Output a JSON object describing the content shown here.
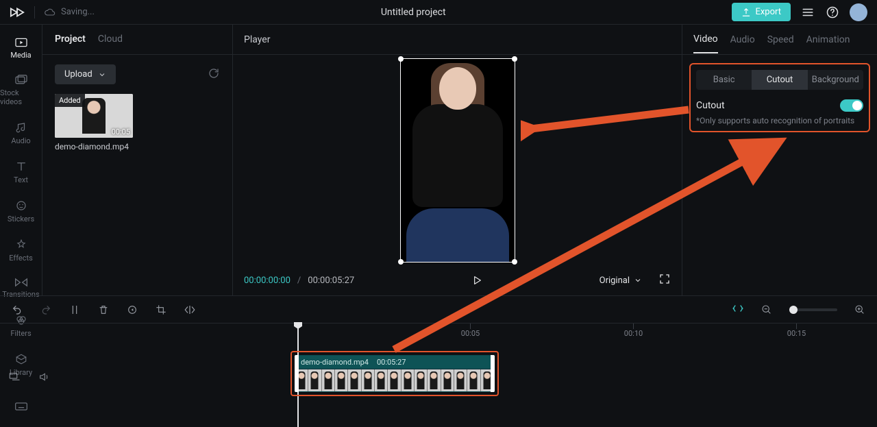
{
  "topbar": {
    "saving": "Saving...",
    "title": "Untitled project",
    "export": "Export"
  },
  "rail": {
    "items": [
      "Media",
      "Stock videos",
      "Audio",
      "Text",
      "Stickers",
      "Effects",
      "Transitions",
      "Filters",
      "Library"
    ]
  },
  "project": {
    "tabs": {
      "project": "Project",
      "cloud": "Cloud"
    },
    "upload": "Upload",
    "asset": {
      "added": "Added",
      "duration": "00:05",
      "name": "demo-diamond.mp4"
    }
  },
  "player": {
    "title": "Player",
    "time_current": "00:00:00:00",
    "time_total": "00:00:05:27",
    "ratio": "Original"
  },
  "inspector": {
    "tabs": [
      "Video",
      "Audio",
      "Speed",
      "Animation"
    ],
    "subtabs": [
      "Basic",
      "Cutout",
      "Background"
    ],
    "cutout": {
      "title": "Cutout",
      "note": "*Only supports auto recognition of portraits"
    }
  },
  "timeline": {
    "ticks": [
      "00:05",
      "00:10",
      "00:15"
    ],
    "clip": {
      "name": "demo-diamond.mp4",
      "duration": "00:05:27"
    }
  }
}
